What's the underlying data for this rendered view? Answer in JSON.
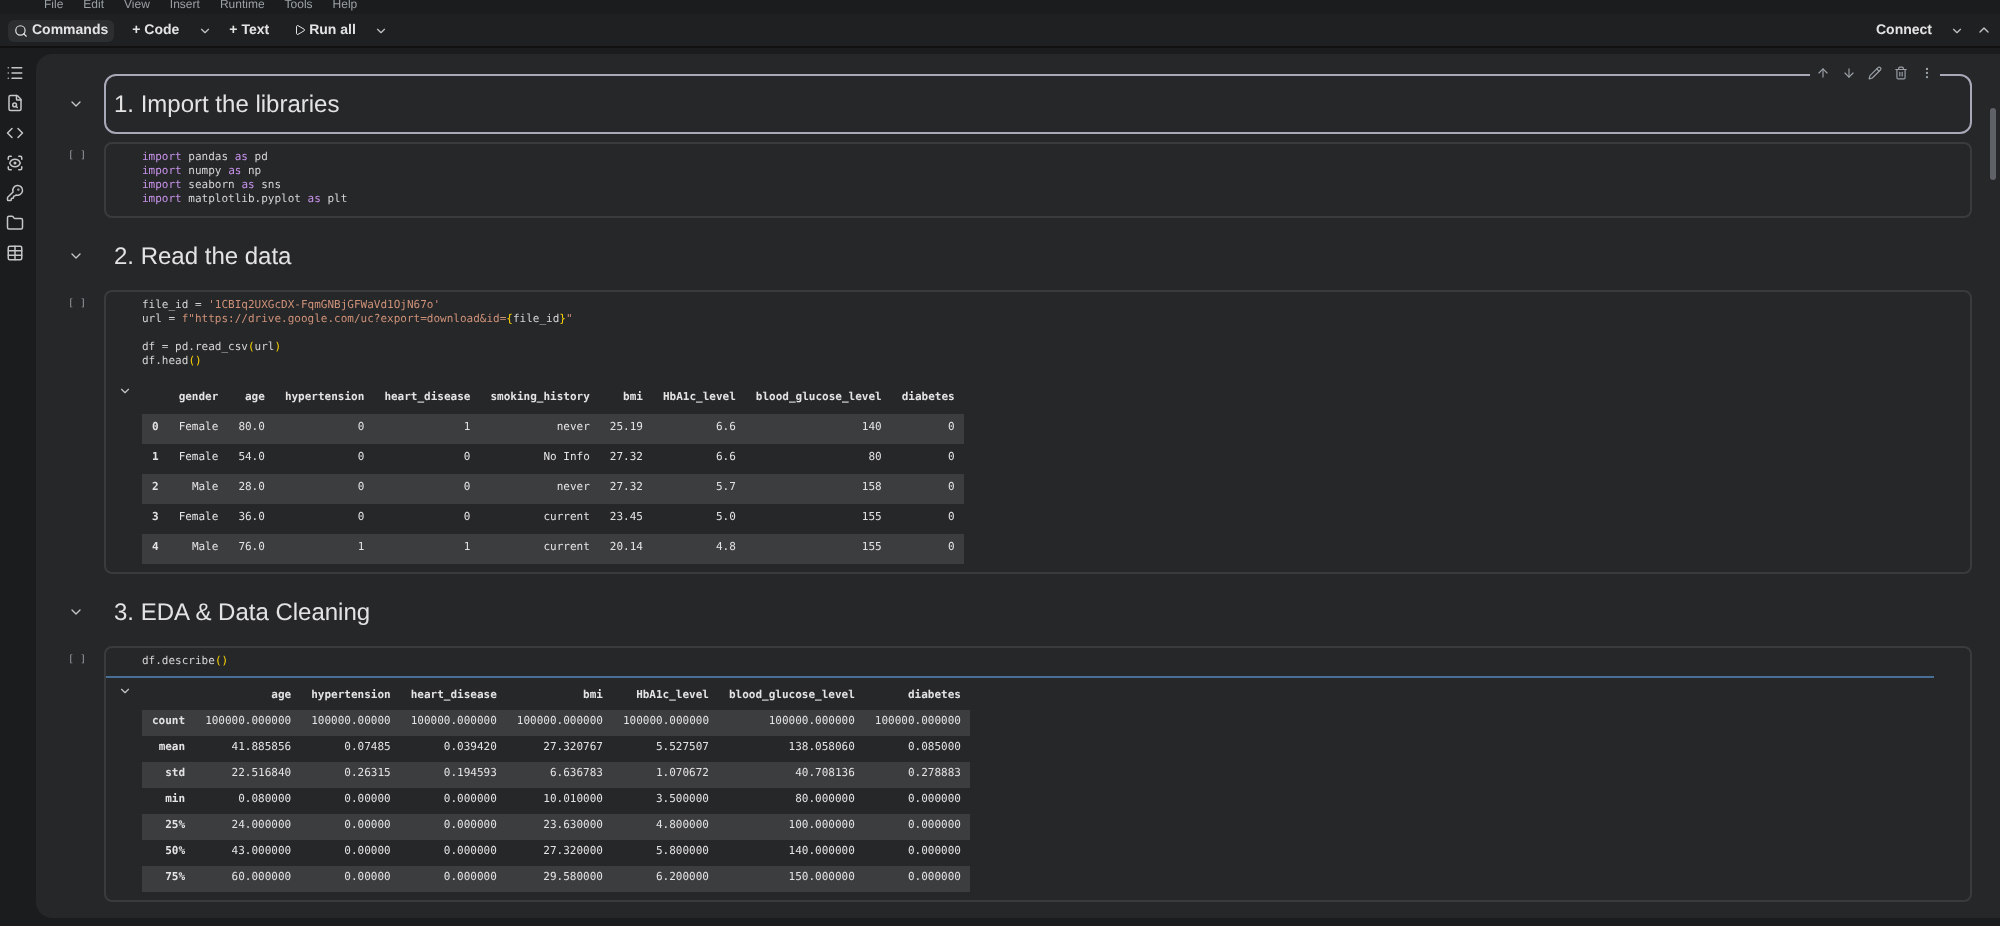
{
  "menu": [
    "File",
    "Edit",
    "View",
    "Insert",
    "Runtime",
    "Tools",
    "Help"
  ],
  "toolbar": {
    "commands": "Commands",
    "code": "+ Code",
    "text": "+ Text",
    "run_all": "Run all",
    "connect": "Connect"
  },
  "cells": [
    {
      "kind": "heading",
      "text": "1. Import the libraries",
      "selected": true
    },
    {
      "kind": "code",
      "run_label": "[ ]",
      "lines": [
        [
          {
            "kind": "keyword",
            "text": "import"
          },
          {
            "kind": "name",
            "text": " pandas "
          },
          {
            "kind": "keyword",
            "text": "as"
          },
          {
            "kind": "name",
            "text": " pd"
          }
        ],
        [
          {
            "kind": "keyword",
            "text": "import"
          },
          {
            "kind": "name",
            "text": " numpy "
          },
          {
            "kind": "keyword",
            "text": "as"
          },
          {
            "kind": "name",
            "text": " np"
          }
        ],
        [
          {
            "kind": "keyword",
            "text": "import"
          },
          {
            "kind": "name",
            "text": " seaborn "
          },
          {
            "kind": "keyword",
            "text": "as"
          },
          {
            "kind": "name",
            "text": " sns"
          }
        ],
        [
          {
            "kind": "keyword",
            "text": "import"
          },
          {
            "kind": "name",
            "text": " matplotlib.pyplot "
          },
          {
            "kind": "keyword",
            "text": "as"
          },
          {
            "kind": "name",
            "text": " plt"
          }
        ]
      ]
    },
    {
      "kind": "heading",
      "text": "2. Read the data",
      "selected": false
    },
    {
      "kind": "code",
      "run_label": "[ ]",
      "lines": [
        [
          {
            "kind": "name",
            "text": "file_id = "
          },
          {
            "kind": "string",
            "text": "'1CBIq2UXGcDX-FqmGNBjGFWaVd1OjN67o'"
          }
        ],
        [
          {
            "kind": "name",
            "text": "url = "
          },
          {
            "kind": "string",
            "text": "f\"https://drive.google.com/uc?export=download&id="
          },
          {
            "kind": "bracket",
            "text": "{"
          },
          {
            "kind": "name",
            "text": "file_id"
          },
          {
            "kind": "bracket",
            "text": "}"
          },
          {
            "kind": "string",
            "text": "\""
          }
        ],
        [
          {
            "kind": "gap"
          },
          {
            "kind": "name",
            "text": "df = pd.read_csv"
          },
          {
            "kind": "bracket",
            "text": "("
          },
          {
            "kind": "name",
            "text": "url"
          },
          {
            "kind": "bracket",
            "text": ")"
          }
        ],
        [
          {
            "kind": "name",
            "text": "df.head"
          },
          {
            "kind": "bracket",
            "text": "()"
          }
        ]
      ],
      "output": {
        "columns": [
          "",
          "gender",
          "age",
          "hypertension",
          "heart_disease",
          "smoking_history",
          "bmi",
          "HbA1c_level",
          "blood_glucose_level",
          "diabetes"
        ],
        "rows": [
          [
            "0",
            "Female",
            "80.0",
            "0",
            "1",
            "never",
            "25.19",
            "6.6",
            "140",
            "0"
          ],
          [
            "1",
            "Female",
            "54.0",
            "0",
            "0",
            "No Info",
            "27.32",
            "6.6",
            "80",
            "0"
          ],
          [
            "2",
            "Male",
            "28.0",
            "0",
            "0",
            "never",
            "27.32",
            "5.7",
            "158",
            "0"
          ],
          [
            "3",
            "Female",
            "36.0",
            "0",
            "0",
            "current",
            "23.45",
            "5.0",
            "155",
            "0"
          ],
          [
            "4",
            "Male",
            "76.0",
            "1",
            "1",
            "current",
            "20.14",
            "4.8",
            "155",
            "0"
          ]
        ]
      }
    },
    {
      "kind": "heading",
      "text": "3. EDA & Data Cleaning",
      "selected": false
    },
    {
      "kind": "code",
      "run_label": "[ ]",
      "lines": [
        [
          {
            "kind": "name",
            "text": "df.describe"
          },
          {
            "kind": "bracket",
            "text": "()"
          }
        ]
      ],
      "output": {
        "columns": [
          "",
          "age",
          "hypertension",
          "heart_disease",
          "bmi",
          "HbA1c_level",
          "blood_glucose_level",
          "diabetes"
        ],
        "rows": [
          [
            "count",
            "100000.000000",
            "100000.00000",
            "100000.000000",
            "100000.000000",
            "100000.000000",
            "100000.000000",
            "100000.000000"
          ],
          [
            "mean",
            "41.885856",
            "0.07485",
            "0.039420",
            "27.320767",
            "5.527507",
            "138.058060",
            "0.085000"
          ],
          [
            "std",
            "22.516840",
            "0.26315",
            "0.194593",
            "6.636783",
            "1.070672",
            "40.708136",
            "0.278883"
          ],
          [
            "min",
            "0.080000",
            "0.00000",
            "0.000000",
            "10.010000",
            "3.500000",
            "80.000000",
            "0.000000"
          ],
          [
            "25%",
            "24.000000",
            "0.00000",
            "0.000000",
            "23.630000",
            "4.800000",
            "100.000000",
            "0.000000"
          ],
          [
            "50%",
            "43.000000",
            "0.00000",
            "0.000000",
            "27.320000",
            "5.800000",
            "140.000000",
            "0.000000"
          ],
          [
            "75%",
            "60.000000",
            "0.00000",
            "0.000000",
            "29.580000",
            "6.200000",
            "150.000000",
            "0.000000"
          ]
        ]
      }
    }
  ]
}
